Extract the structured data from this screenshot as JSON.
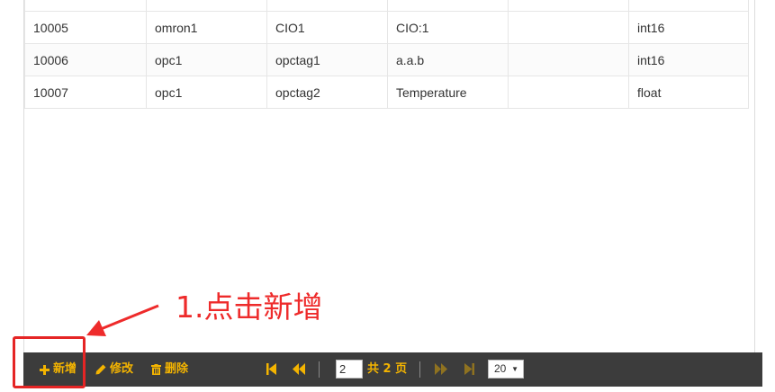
{
  "table": {
    "rows": [
      {
        "cells": [
          "",
          "",
          "",
          "",
          "",
          ""
        ]
      },
      {
        "cells": [
          "10005",
          "omron1",
          "CIO1",
          "CIO:1",
          "",
          "int16"
        ]
      },
      {
        "cells": [
          "10006",
          "opc1",
          "opctag1",
          "a.a.b",
          "",
          "int16"
        ]
      },
      {
        "cells": [
          "10007",
          "opc1",
          "opctag2",
          "Temperature",
          "",
          "float"
        ]
      }
    ]
  },
  "annotation": {
    "text": "1.点击新增",
    "color": "#ee2b2b"
  },
  "toolbar": {
    "add_label": "新增",
    "edit_label": "修改",
    "delete_label": "删除",
    "add_icon": "plus-icon",
    "edit_icon": "pencil-icon",
    "delete_icon": "trash-icon",
    "accent_color": "#f4b400",
    "background_color": "#3c3c3c"
  },
  "pagination": {
    "current_page": "2",
    "total_pages_text": "共 2 页",
    "page_size": "20"
  }
}
